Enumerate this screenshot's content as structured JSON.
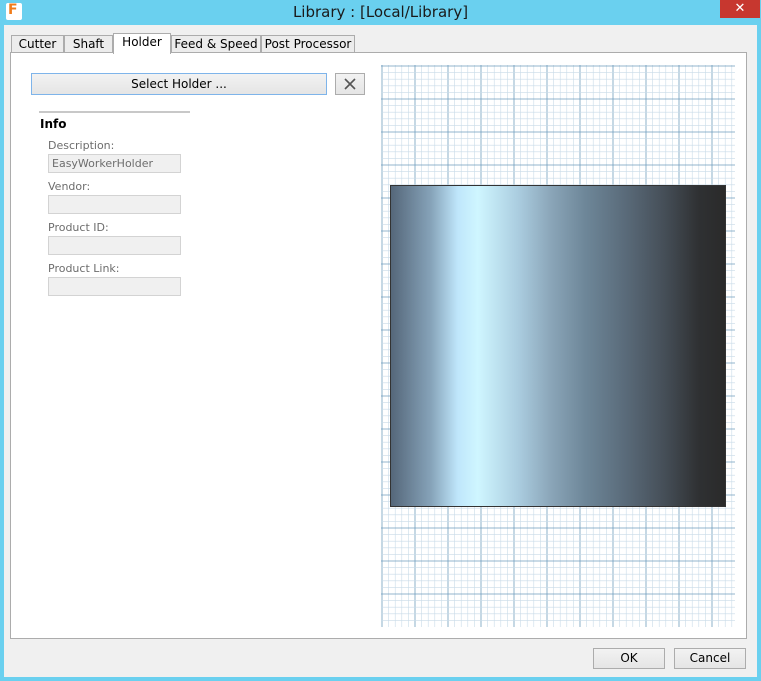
{
  "window": {
    "title": "Library :  [Local/Library]",
    "app_icon_letter": "F",
    "close_glyph": "✕",
    "icons": {
      "app": "fusion-app-icon",
      "close": "close-icon"
    }
  },
  "tabs": [
    {
      "label": "Cutter",
      "active": false
    },
    {
      "label": "Shaft",
      "active": false
    },
    {
      "label": "Holder",
      "active": true
    },
    {
      "label": "Feed & Speed",
      "active": false
    },
    {
      "label": "Post Processor",
      "active": false
    }
  ],
  "holder": {
    "select_label": "Select Holder ...",
    "clear_icon": "clear-x-icon"
  },
  "info": {
    "heading": "Info",
    "description": {
      "label": "Description:",
      "value": "EasyWorkerHolder"
    },
    "vendor": {
      "label": "Vendor:",
      "value": ""
    },
    "product_id": {
      "label": "Product ID:",
      "value": ""
    },
    "product_link": {
      "label": "Product Link:",
      "value": ""
    }
  },
  "footer": {
    "ok_label": "OK",
    "cancel_label": "Cancel"
  },
  "colors": {
    "titlebar": "#6ad0ef",
    "close": "#c7372f",
    "grid_minor": "#c9dbe8",
    "grid_major": "#6f9dbd",
    "focus_border": "#7eb4ea"
  }
}
